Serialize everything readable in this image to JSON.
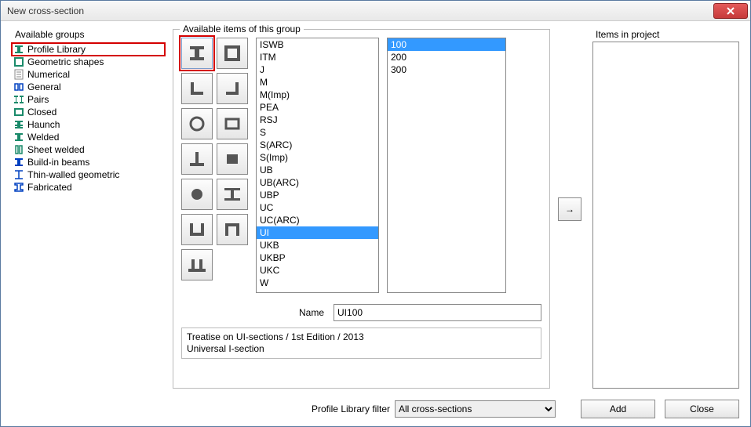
{
  "window": {
    "title": "New cross-section"
  },
  "groups": {
    "label": "Available groups",
    "items": [
      "Profile Library",
      "Geometric shapes",
      "Numerical",
      "General",
      "Pairs",
      "Closed",
      "Haunch",
      "Welded",
      "Sheet welded",
      "Build-in beams",
      "Thin-walled geometric",
      "Fabricated"
    ],
    "selected_index": 0
  },
  "items_group": {
    "label": "Available items of this group",
    "shape_buttons": [
      "i-beam",
      "box",
      "angle-l",
      "angle-j",
      "hollow-circle",
      "rect-hollow",
      "tee",
      "rect-solid",
      "solid-circle",
      "i-beam-wide",
      "u-up",
      "u-down",
      "wide-flange"
    ],
    "selected_shape_index": 0,
    "type_list": [
      "ISWB",
      "ITM",
      "J",
      "M",
      "M(Imp)",
      "PEA",
      "RSJ",
      "S",
      "S(ARC)",
      "S(Imp)",
      "UB",
      "UB(ARC)",
      "UBP",
      "UC",
      "UC(ARC)",
      "UI",
      "UKB",
      "UKBP",
      "UKC",
      "W"
    ],
    "type_selected_index": 15,
    "size_list": [
      "100",
      "200",
      "300"
    ],
    "size_selected_index": 0,
    "arrow_label": "→"
  },
  "name_row": {
    "label": "Name",
    "value": "UI100"
  },
  "info": {
    "line1": "Treatise on UI-sections / 1st Edition / 2013",
    "line2": "Universal I-section"
  },
  "project": {
    "label": "Items in project"
  },
  "filter": {
    "label": "Profile Library filter",
    "value": "All cross-sections"
  },
  "buttons": {
    "add": "Add",
    "close": "Close"
  }
}
